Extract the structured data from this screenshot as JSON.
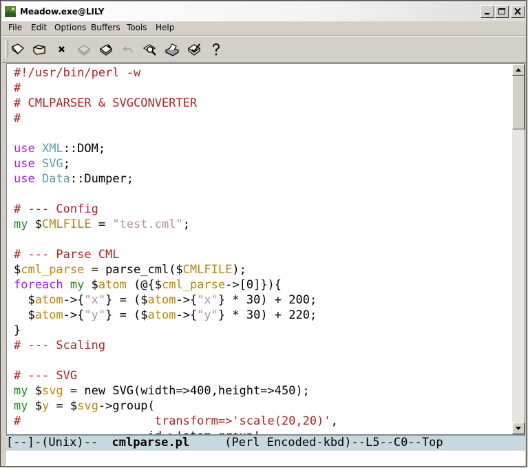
{
  "window": {
    "title": "Meadow.exe@LILY"
  },
  "menu": [
    "File",
    "Edit",
    "Options",
    "Buffers",
    "Tools",
    "Help"
  ],
  "toolbar": {
    "icons": [
      "new-file-icon",
      "open-folder-icon",
      "close-icon",
      "save-disk-icon",
      "save-as-icon",
      "undo-icon",
      "search-icon",
      "print-icon",
      "customize-icon",
      "help-icon"
    ]
  },
  "editor": {
    "lines": [
      [
        {
          "t": "#!/usr/bin/perl -w",
          "c": "c"
        }
      ],
      [
        {
          "t": "#",
          "c": "c"
        }
      ],
      [
        {
          "t": "# CMLPARSER & SVGCONVERTER",
          "c": "c"
        }
      ],
      [
        {
          "t": "#",
          "c": "c"
        }
      ],
      [],
      [
        {
          "t": "use",
          "c": "k"
        },
        {
          "t": " "
        },
        {
          "t": "XML",
          "c": "p"
        },
        {
          "t": "::DOM;"
        }
      ],
      [
        {
          "t": "use",
          "c": "k"
        },
        {
          "t": " "
        },
        {
          "t": "SVG",
          "c": "p"
        },
        {
          "t": ";"
        }
      ],
      [
        {
          "t": "use",
          "c": "k"
        },
        {
          "t": " "
        },
        {
          "t": "Data",
          "c": "p"
        },
        {
          "t": "::Dumper;"
        }
      ],
      [],
      [
        {
          "t": "# --- Config",
          "c": "c"
        }
      ],
      [
        {
          "t": "my",
          "c": "t"
        },
        {
          "t": " $"
        },
        {
          "t": "CMLFILE",
          "c": "v"
        },
        {
          "t": " = "
        },
        {
          "t": "\"test.cml\"",
          "c": "s"
        },
        {
          "t": ";"
        }
      ],
      [],
      [
        {
          "t": "# --- Parse CML",
          "c": "c"
        }
      ],
      [
        {
          "t": "$"
        },
        {
          "t": "cml_parse",
          "c": "v"
        },
        {
          "t": " = parse_cml($"
        },
        {
          "t": "CMLFILE",
          "c": "v"
        },
        {
          "t": ");"
        }
      ],
      [
        {
          "t": "foreach",
          "c": "k"
        },
        {
          "t": " "
        },
        {
          "t": "my",
          "c": "t"
        },
        {
          "t": " $"
        },
        {
          "t": "atom",
          "c": "v"
        },
        {
          "t": " (@{$"
        },
        {
          "t": "cml_parse",
          "c": "v"
        },
        {
          "t": "->[0]}){"
        }
      ],
      [
        {
          "t": "  $"
        },
        {
          "t": "atom",
          "c": "v"
        },
        {
          "t": "->{"
        },
        {
          "t": "\"x\"",
          "c": "s"
        },
        {
          "t": "} = ($"
        },
        {
          "t": "atom",
          "c": "v"
        },
        {
          "t": "->{"
        },
        {
          "t": "\"x\"",
          "c": "s"
        },
        {
          "t": "} * 30) + 200;"
        }
      ],
      [
        {
          "t": "  $"
        },
        {
          "t": "atom",
          "c": "v"
        },
        {
          "t": "->{"
        },
        {
          "t": "\"y\"",
          "c": "s"
        },
        {
          "t": "} = ($"
        },
        {
          "t": "atom",
          "c": "v"
        },
        {
          "t": "->{"
        },
        {
          "t": "\"y\"",
          "c": "s"
        },
        {
          "t": "} * 30) + 220;"
        }
      ],
      [
        {
          "t": "}"
        }
      ],
      [
        {
          "t": "# --- Scaling",
          "c": "c"
        }
      ],
      [],
      [
        {
          "t": "# --- SVG",
          "c": "c"
        }
      ],
      [
        {
          "t": "my",
          "c": "t"
        },
        {
          "t": " $"
        },
        {
          "t": "svg",
          "c": "v"
        },
        {
          "t": " = new SVG(width=>400,height=>450);"
        }
      ],
      [
        {
          "t": "my",
          "c": "t"
        },
        {
          "t": " $"
        },
        {
          "t": "y",
          "c": "v"
        },
        {
          "t": " = $"
        },
        {
          "t": "svg",
          "c": "v"
        },
        {
          "t": "->group("
        }
      ],
      [
        {
          "t": "#",
          "c": "c"
        },
        {
          "t": "                   "
        },
        {
          "t": "transform=>",
          "c": "c"
        },
        {
          "t": "'scale(20,20)'",
          "c": "c"
        },
        {
          "t": ","
        }
      ],
      [
        {
          "t": "                   id=>'atom_group'"
        }
      ]
    ]
  },
  "modeline": {
    "prefix": "[--]-(Unix)--  ",
    "buffer": "cmlparse.pl",
    "suffix": "     (Perl Encoded-kbd)--L5--C0--Top"
  }
}
